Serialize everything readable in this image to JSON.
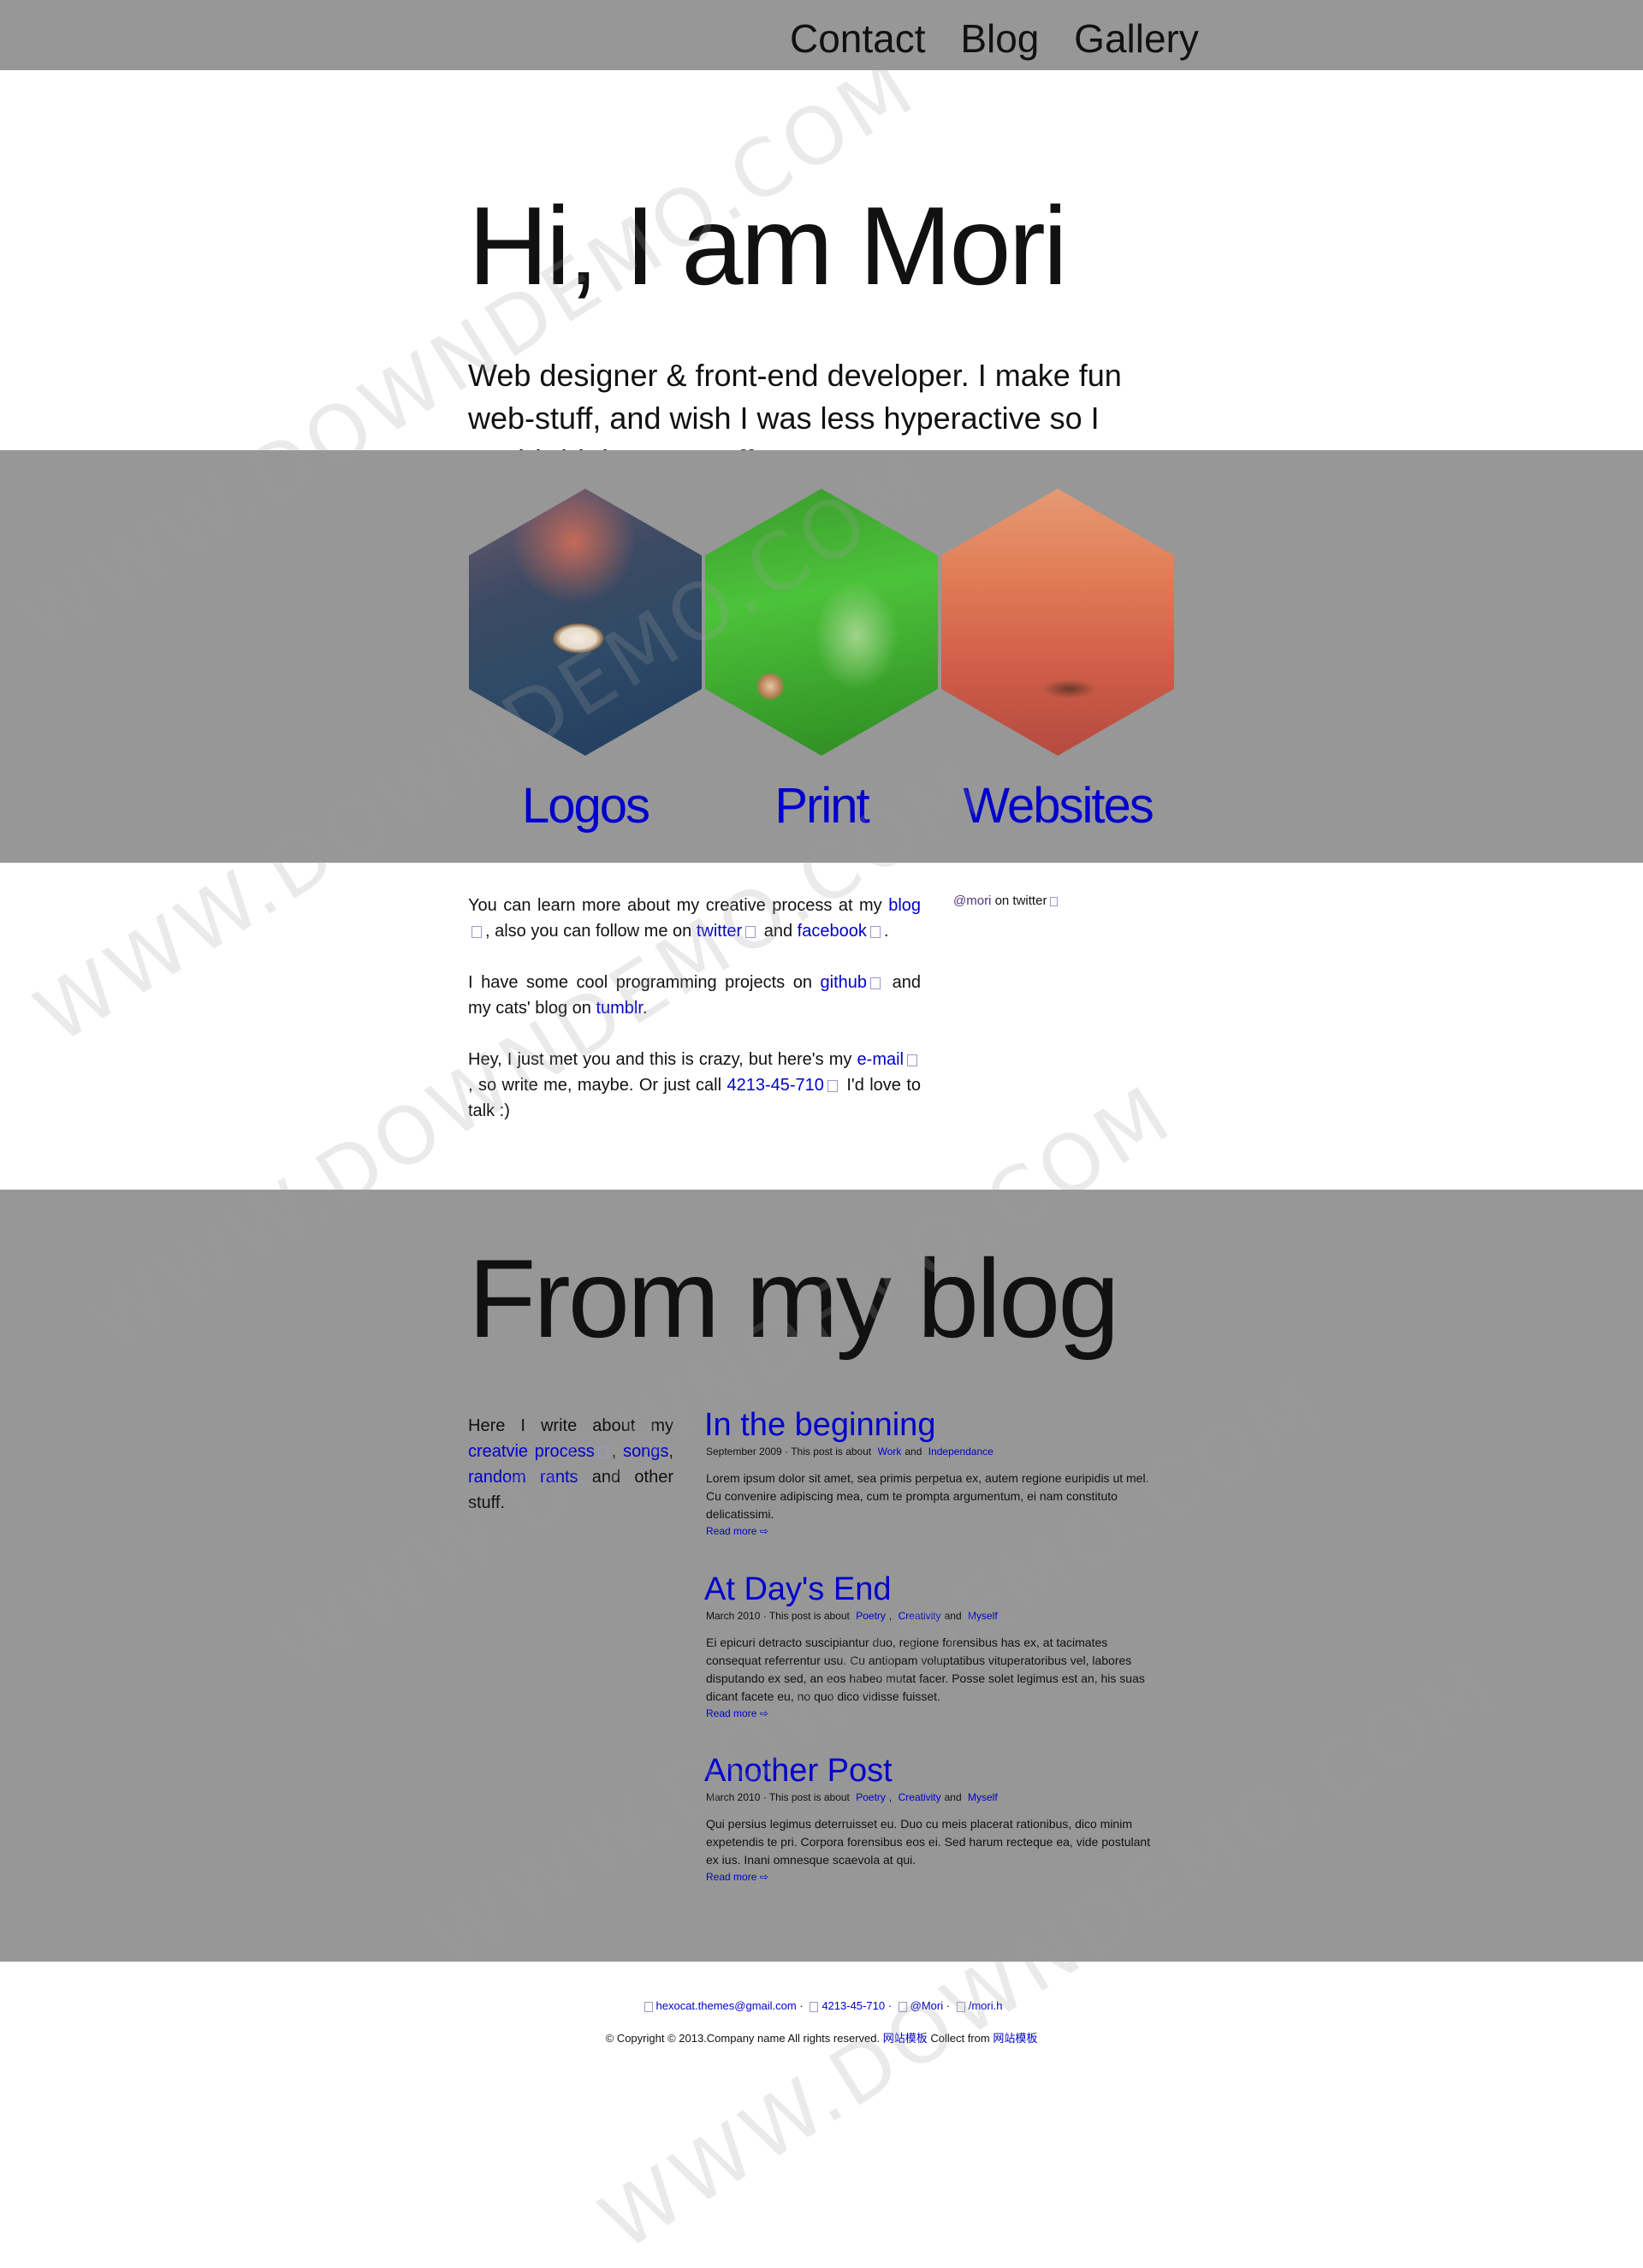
{
  "nav": {
    "items": [
      "Contact",
      "Blog",
      "Gallery"
    ]
  },
  "hero": {
    "title": "Hi, I am Mori",
    "subtitle": "Web designer & front-end developer. I make fun web-stuff, and wish I was less hyperactive so I could drink more coffee."
  },
  "gallery": {
    "items": [
      {
        "label": "Logos",
        "image": "shell-on-blue-sand"
      },
      {
        "label": "Print",
        "image": "shell-in-grass"
      },
      {
        "label": "Websites",
        "image": "orange-water"
      }
    ]
  },
  "about": {
    "p1_a": "You can learn more about my creative process at my",
    "p1_blog": "blog",
    "p1_b": ", also you can follow me on",
    "p1_twitter": "twitter",
    "p1_and": "and",
    "p1_facebook": "facebook",
    "p1_end": ".",
    "p2_a": "I have some cool programming projects on",
    "p2_github": "github",
    "p2_b": "and my cats' blog on",
    "p2_tumblr": "tumblr",
    "p2_end": ".",
    "p3_a": "Hey, I just met you and this is crazy, but here's my",
    "p3_email": "e-mail",
    "p3_b": ", so write me, maybe. Or just call",
    "p3_phone": "4213-45-710",
    "p3_c": "I'd love to talk :)",
    "twitter_handle": "@mori",
    "twitter_suffix": "on twitter"
  },
  "blog": {
    "title": "From my blog",
    "intro_a": "Here I write about my",
    "intro_link1": "creatvie process",
    "intro_sep": ",",
    "intro_link2": "songs",
    "intro_link3": "random rants",
    "intro_b": "and other stuff.",
    "read_more": "Read more ⇨",
    "posts": [
      {
        "title": "In the beginning",
        "date": "September 2009",
        "about": "· This post is about",
        "tags": [
          "Work",
          "Independance"
        ],
        "body": "Lorem ipsum dolor sit amet, sea primis perpetua ex, autem regione euripidis ut mel. Cu convenire adipiscing mea, cum te prompta argumentum, ei nam constituto delicatissimi."
      },
      {
        "title": "At Day's End",
        "date": "March 2010",
        "about": "· This post is about",
        "tags": [
          "Poetry",
          "Creativity",
          "Myself"
        ],
        "body": "Ei epicuri detracto suscipiantur duo, regione forensibus has ex, at tacimates consequat referrentur usu. Cu antiopam voluptatibus vituperatoribus vel, labores disputando ex sed, an eos habeo mutat facer. Posse solet legimus est an, his suas dicant facete eu, no quo dico vidisse fuisset."
      },
      {
        "title": "Another Post",
        "date": "March 2010",
        "about": "· This post is about",
        "tags": [
          "Poetry",
          "Creativity",
          "Myself"
        ],
        "body": "Qui persius legimus deterruisset eu. Duo cu meis placerat rationibus, dico minim expetendis te pri. Corpora forensibus eos ei. Sed harum recteque ea, vide postulant ex ius. Inani omnesque scaevola at qui."
      }
    ],
    "tag_and": "and",
    "tag_comma": ","
  },
  "footer": {
    "email": "hexocat.themes@gmail.com",
    "phone": "4213-45-710",
    "twitter": "@Mori",
    "site": "/mori.h",
    "dot": "·",
    "copyright": "© Copyright © 2013.Company name All rights reserved.",
    "link1": "网站模板",
    "collect": "Collect from",
    "link2": "网站模板"
  },
  "watermark": "WWW.DOWNDEMO.COM",
  "colors": {
    "gray_band": "#979797",
    "link": "#0000cc",
    "text": "#111111"
  }
}
